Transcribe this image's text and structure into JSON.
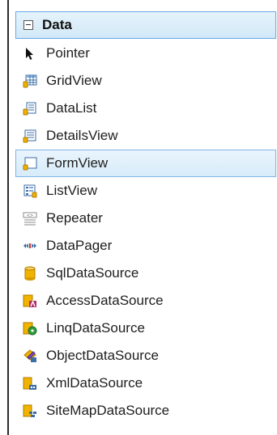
{
  "toolbox": {
    "group": {
      "title": "Data",
      "expanded": true
    },
    "items": [
      {
        "label": "Pointer",
        "icon": "pointer-icon"
      },
      {
        "label": "GridView",
        "icon": "gridview-icon"
      },
      {
        "label": "DataList",
        "icon": "datalist-icon"
      },
      {
        "label": "DetailsView",
        "icon": "detailsview-icon"
      },
      {
        "label": "FormView",
        "icon": "formview-icon",
        "selected": true
      },
      {
        "label": "ListView",
        "icon": "listview-icon"
      },
      {
        "label": "Repeater",
        "icon": "repeater-icon"
      },
      {
        "label": "DataPager",
        "icon": "datapager-icon"
      },
      {
        "label": "SqlDataSource",
        "icon": "sqldatasource-icon"
      },
      {
        "label": "AccessDataSource",
        "icon": "accessdatasource-icon"
      },
      {
        "label": "LinqDataSource",
        "icon": "linqdatasource-icon"
      },
      {
        "label": "ObjectDataSource",
        "icon": "objectdatasource-icon"
      },
      {
        "label": "XmlDataSource",
        "icon": "xmldatasource-icon"
      },
      {
        "label": "SiteMapDataSource",
        "icon": "sitemapdatasource-icon"
      }
    ]
  },
  "colors": {
    "selection_border": "#7fb2e6",
    "selection_fill": "#d7ebf9",
    "cylinder": "#f0b400"
  }
}
